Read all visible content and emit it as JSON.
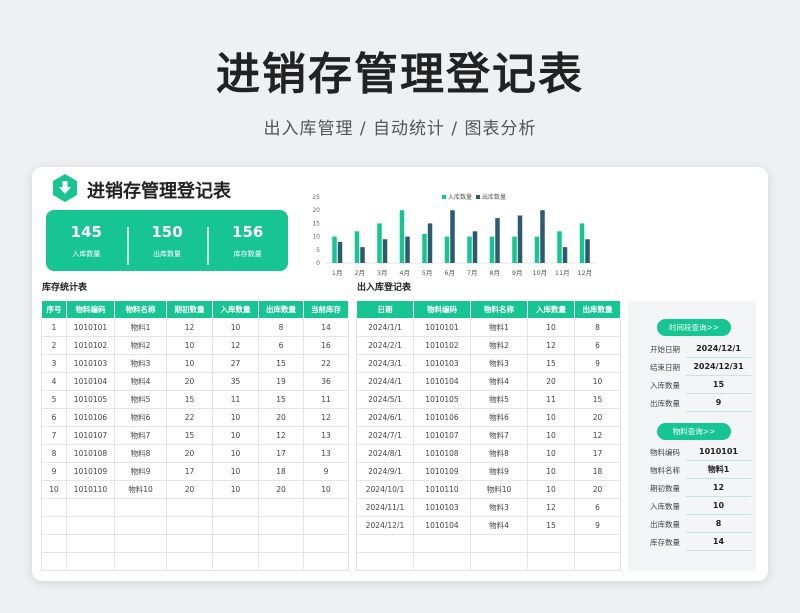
{
  "header": {
    "title": "进销存管理登记表",
    "subtitle": "出入库管理 / 自动统计 / 图表分析"
  },
  "sheet": {
    "title": "进销存管理登记表"
  },
  "colors": {
    "accent": "#16c591",
    "dark": "#2e5a6e"
  },
  "stats": [
    {
      "value": "145",
      "label": "入库数量"
    },
    {
      "value": "150",
      "label": "出库数量"
    },
    {
      "value": "156",
      "label": "库存数量"
    }
  ],
  "chart_data": {
    "type": "bar",
    "categories": [
      "1月",
      "2月",
      "3月",
      "4月",
      "5月",
      "6月",
      "7月",
      "8月",
      "9月",
      "10月",
      "11月",
      "12月"
    ],
    "series": [
      {
        "name": "入库数量",
        "color": "#16c591",
        "values": [
          10,
          12,
          15,
          20,
          11,
          10,
          10,
          10,
          10,
          10,
          12,
          15
        ]
      },
      {
        "name": "出库数量",
        "color": "#2e5a6e",
        "values": [
          8,
          6,
          9,
          10,
          15,
          20,
          12,
          17,
          18,
          20,
          6,
          9
        ]
      }
    ],
    "yticks": [
      "25",
      "20",
      "15",
      "10",
      "5",
      "0"
    ],
    "ylim": [
      0,
      25
    ],
    "legend_position": "top"
  },
  "inventory": {
    "title": "库存统计表",
    "columns": [
      "序号",
      "物料编码",
      "物料名称",
      "期初数量",
      "入库数量",
      "出库数量",
      "当前库存"
    ],
    "rows": [
      [
        "1",
        "1010101",
        "物料1",
        "12",
        "10",
        "8",
        "14"
      ],
      [
        "2",
        "1010102",
        "物料2",
        "10",
        "12",
        "6",
        "16"
      ],
      [
        "3",
        "1010103",
        "物料3",
        "10",
        "27",
        "15",
        "22"
      ],
      [
        "4",
        "1010104",
        "物料4",
        "20",
        "35",
        "19",
        "36"
      ],
      [
        "5",
        "1010105",
        "物料5",
        "15",
        "11",
        "15",
        "11"
      ],
      [
        "6",
        "1010106",
        "物料6",
        "22",
        "10",
        "20",
        "12"
      ],
      [
        "7",
        "1010107",
        "物料7",
        "15",
        "10",
        "12",
        "13"
      ],
      [
        "8",
        "1010108",
        "物料8",
        "20",
        "10",
        "17",
        "13"
      ],
      [
        "9",
        "1010109",
        "物料9",
        "17",
        "10",
        "18",
        "9"
      ],
      [
        "10",
        "1010110",
        "物料10",
        "20",
        "10",
        "20",
        "10"
      ]
    ]
  },
  "register": {
    "title": "出入库登记表",
    "columns": [
      "日期",
      "物料编码",
      "物料名称",
      "入库数量",
      "出库数量"
    ],
    "rows": [
      [
        "2024/1/1",
        "1010101",
        "物料1",
        "10",
        "8"
      ],
      [
        "2024/2/1",
        "1010102",
        "物料2",
        "12",
        "6"
      ],
      [
        "2024/3/1",
        "1010103",
        "物料3",
        "15",
        "9"
      ],
      [
        "2024/4/1",
        "1010104",
        "物料4",
        "20",
        "10"
      ],
      [
        "2024/5/1",
        "1010105",
        "物料5",
        "11",
        "15"
      ],
      [
        "2024/6/1",
        "1010106",
        "物料6",
        "10",
        "20"
      ],
      [
        "2024/7/1",
        "1010107",
        "物料7",
        "10",
        "12"
      ],
      [
        "2024/8/1",
        "1010108",
        "物料8",
        "10",
        "17"
      ],
      [
        "2024/9/1",
        "1010109",
        "物料9",
        "10",
        "18"
      ],
      [
        "2024/10/1",
        "1010110",
        "物料10",
        "10",
        "20"
      ],
      [
        "2024/11/1",
        "1010103",
        "物料3",
        "12",
        "6"
      ],
      [
        "2024/12/1",
        "1010104",
        "物料4",
        "15",
        "9"
      ]
    ]
  },
  "date_query": {
    "button": "时间段查询>>",
    "fields": [
      {
        "label": "开始日期",
        "value": "2024/12/1"
      },
      {
        "label": "结束日期",
        "value": "2024/12/31"
      },
      {
        "label": "入库数量",
        "value": "15"
      },
      {
        "label": "出库数量",
        "value": "9"
      }
    ]
  },
  "material_query": {
    "button": "物料查询>>",
    "fields": [
      {
        "label": "物料编码",
        "value": "1010101"
      },
      {
        "label": "物料名称",
        "value": "物料1"
      },
      {
        "label": "期初数量",
        "value": "12"
      },
      {
        "label": "入库数量",
        "value": "10"
      },
      {
        "label": "出库数量",
        "value": "8"
      },
      {
        "label": "库存数量",
        "value": "14"
      }
    ]
  }
}
